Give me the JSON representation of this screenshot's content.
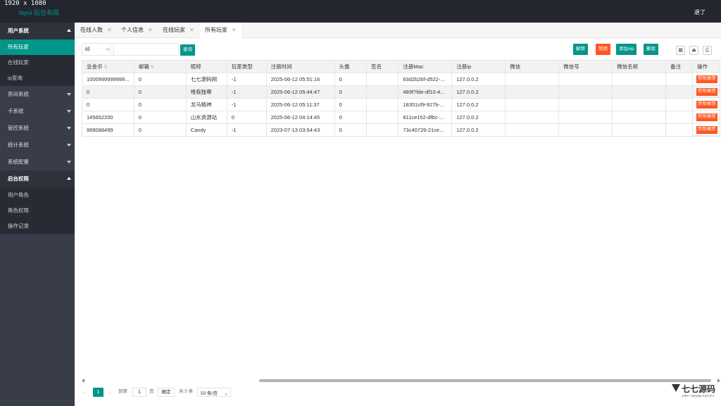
{
  "topbar": {
    "resolution": "1920 x 1080",
    "brand": "layui 后台布局",
    "logout": "退了"
  },
  "sidebar": {
    "groups": [
      {
        "label": "用户系统",
        "open": true,
        "items": [
          "所有玩家",
          "在线玩家",
          "ip查询"
        ]
      },
      {
        "label": "房间系统"
      },
      {
        "label": "卡系统"
      },
      {
        "label": "管控系统"
      },
      {
        "label": "统计系统"
      },
      {
        "label": "系统配置"
      },
      {
        "label": "后台权限",
        "open": true,
        "items": [
          "用户角色",
          "角色权限",
          "操作记录"
        ]
      }
    ],
    "active_item": "所有玩家"
  },
  "tabs": [
    "在线人数",
    "个人信息",
    "在线玩家",
    "所有玩家"
  ],
  "active_tab": "所有玩家",
  "toolbar": {
    "select_value": "id",
    "search_input_value": "",
    "search_button": "查询",
    "unban_button": "解禁",
    "ban_button": "禁用",
    "add_vip_button": "添加vip",
    "delete_button": "删除",
    "tool_icons": [
      "columns-icon",
      "export-icon",
      "print-icon"
    ]
  },
  "table": {
    "headers": [
      "总金币",
      "邮箱",
      "昵称",
      "玩家类型",
      "注册时间",
      "头像",
      "签名",
      "注册Mac",
      "注册ip",
      "微信",
      "微信号",
      "微信名称",
      "备注",
      "操作"
    ],
    "rows": [
      [
        "1000999999999...",
        "0",
        "七七源码网",
        "-1",
        "2025-06-12 05:51:16",
        "0",
        "",
        "63d2b26f-d522-...",
        "127.0.0.2",
        "",
        "",
        "",
        ""
      ],
      [
        "0",
        "0",
        "唯我独尊",
        "-1",
        "2025-06-12 05:44:47",
        "0",
        "",
        "489f7fde-df10-4...",
        "127.0.0.2",
        "",
        "",
        "",
        ""
      ],
      [
        "0",
        "0",
        "龙马精神",
        "-1",
        "2025-06-12 05:11:37",
        "0",
        "",
        "18351cf9-927b-...",
        "127.0.0.2",
        "",
        "",
        "",
        ""
      ],
      [
        "145652200",
        "0",
        "山水资源站",
        "0",
        "2025-06-12 04:14:45",
        "0",
        "",
        "811ce152-dfbc-...",
        "127.0.0.2",
        "",
        "",
        "",
        ""
      ],
      [
        "999088499",
        "0",
        "Candy",
        "-1",
        "2023-07-13 03:54:43",
        "0",
        "",
        "73c40729-21ce...",
        "127.0.0.2",
        "",
        "",
        "",
        ""
      ]
    ],
    "op_label": "禁用/解禁"
  },
  "pager": {
    "current": "1",
    "goto_label": "到第",
    "page_input": "1",
    "page_unit": "页",
    "confirm": "确定",
    "total": "共 5 条",
    "per_page": "50 条/页"
  },
  "watermark": {
    "title": "七七源码",
    "subtitle": "分享不一样的资源 开发与学习"
  }
}
